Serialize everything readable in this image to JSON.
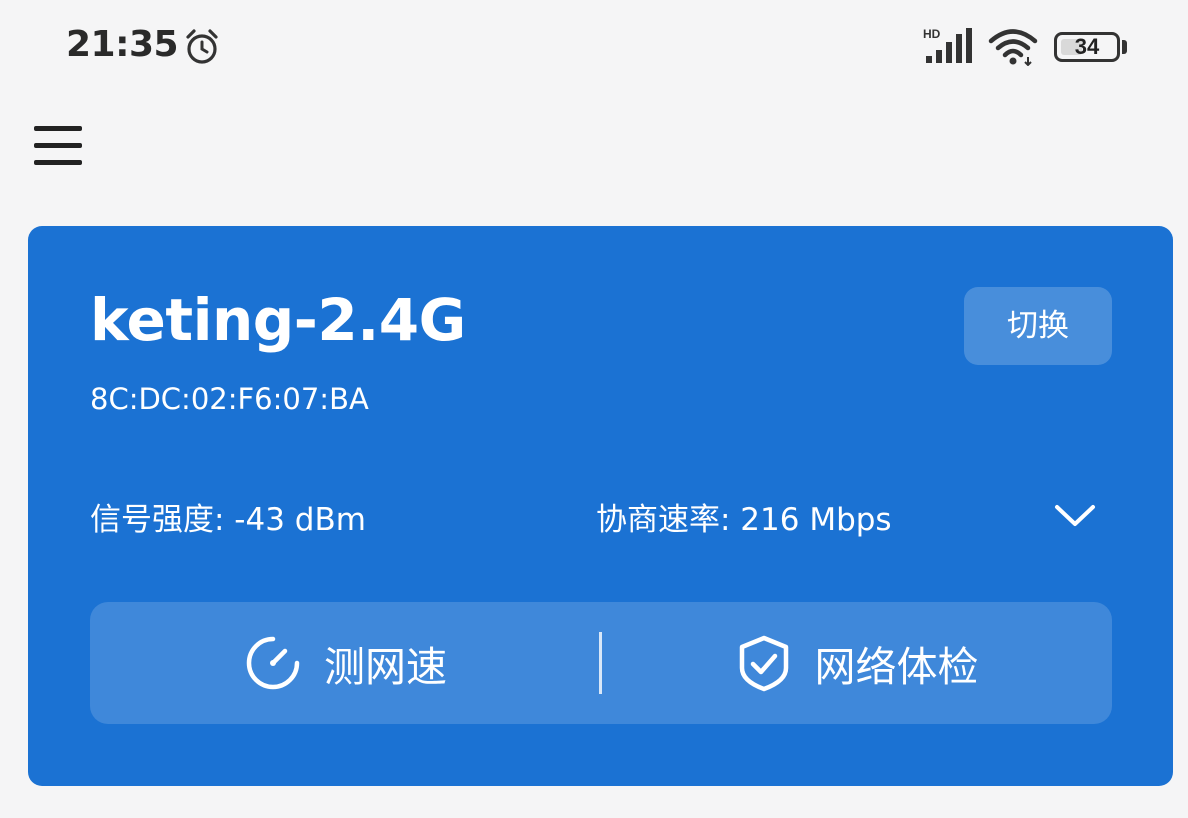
{
  "status_bar": {
    "time": "21:35",
    "battery_level": "34",
    "network_badge": "HD",
    "icons": [
      "alarm-clock-icon",
      "cellular-signal-icon",
      "wifi-signal-icon",
      "battery-icon"
    ]
  },
  "header": {
    "menu_icon": "hamburger-menu-icon"
  },
  "network": {
    "ssid": "keting-2.4G",
    "bssid": "8C:DC:02:F6:07:BA",
    "switch_label": "切换",
    "signal_strength": "信号强度: -43 dBm",
    "link_rate": "协商速率: 216 Mbps",
    "expand_icon": "chevron-down-icon"
  },
  "actions": [
    {
      "label": "测网速",
      "icon": "speedometer-icon"
    },
    {
      "label": "网络体检",
      "icon": "shield-check-icon"
    }
  ],
  "colors": {
    "card_background": "#1b72d3",
    "page_background": "#f5f5f6",
    "text_on_card": "#ffffff"
  }
}
